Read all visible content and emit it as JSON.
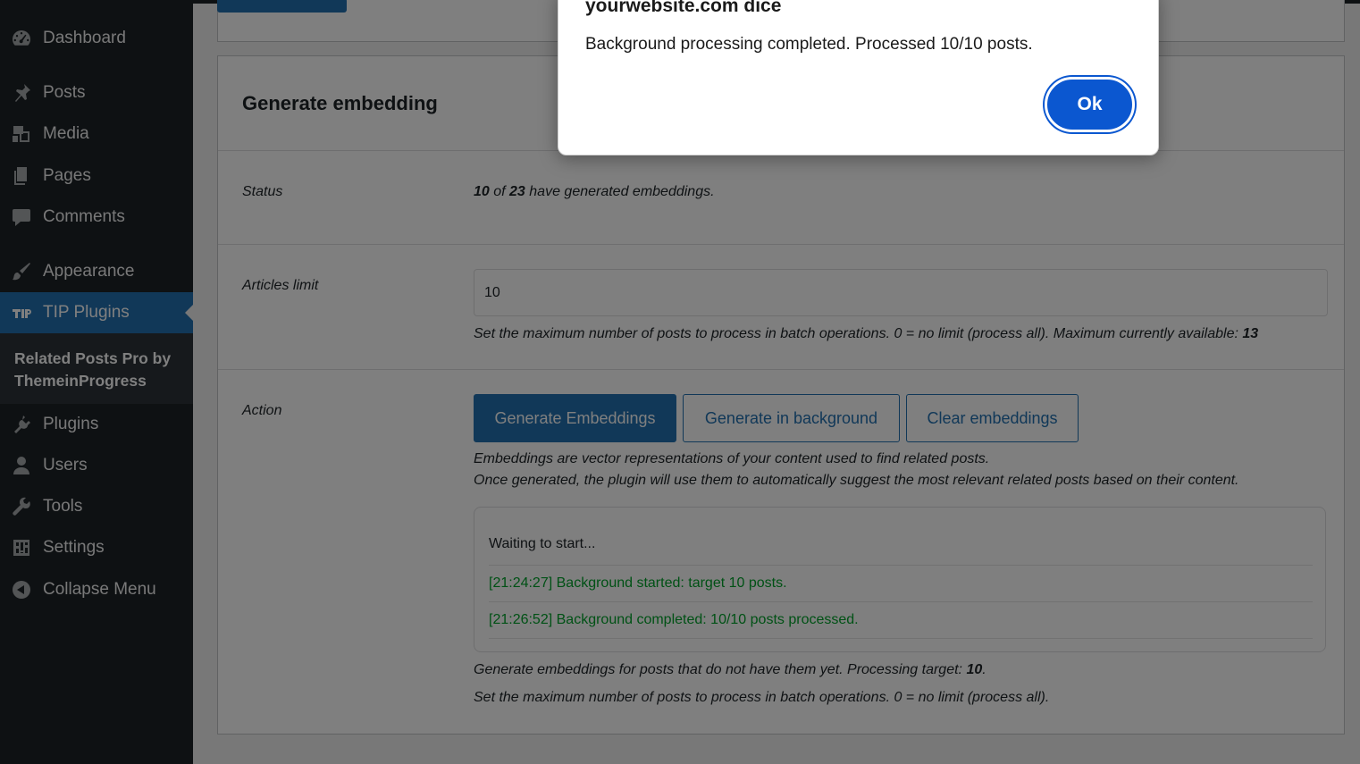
{
  "sidebar": {
    "items": [
      {
        "label": "Dashboard",
        "icon": "dashboard-icon"
      },
      {
        "label": "Posts",
        "icon": "pin-icon"
      },
      {
        "label": "Media",
        "icon": "media-icon"
      },
      {
        "label": "Pages",
        "icon": "pages-icon"
      },
      {
        "label": "Comments",
        "icon": "comment-icon"
      },
      {
        "label": "Appearance",
        "icon": "brush-icon"
      },
      {
        "label": "TIP Plugins",
        "icon": "tip-icon",
        "active": true
      },
      {
        "label": "Plugins",
        "icon": "plug-icon"
      },
      {
        "label": "Users",
        "icon": "user-icon"
      },
      {
        "label": "Tools",
        "icon": "wrench-icon"
      },
      {
        "label": "Settings",
        "icon": "sliders-icon"
      },
      {
        "label": "Collapse Menu",
        "icon": "collapse-icon"
      }
    ],
    "submenu_label": "Related Posts Pro by ThemeinProgress"
  },
  "card": {
    "title": "Generate embedding",
    "status": {
      "label": "Status",
      "done": "10",
      "of": " of ",
      "total": "23",
      "suffix": " have generated embeddings."
    },
    "limit": {
      "label": "Articles limit",
      "value": "10",
      "desc_prefix": "Set the maximum number of posts to process in batch operations. 0 = no limit (process all). Maximum currently available: ",
      "max_available": "13"
    },
    "action": {
      "label": "Action",
      "btn_generate": "Generate Embeddings",
      "btn_background": "Generate in background",
      "btn_clear": "Clear embeddings",
      "desc_line1": "Embeddings are vector representations of your content used to find related posts.",
      "desc_line2": "Once generated, the plugin will use them to automatically suggest the most relevant related posts based on their content.",
      "log": {
        "waiting": "Waiting to start...",
        "line1": "[21:24:27] Background started: target 10 posts.",
        "line2": "[21:26:52] Background completed: 10/10 posts processed."
      },
      "target_prefix": "Generate embeddings for posts that do not have them yet. Processing target: ",
      "target_value": "10",
      "target_suffix": ".",
      "limit_note": "Set the maximum number of posts to process in batch operations. 0 = no limit (process all)."
    }
  },
  "dialog": {
    "title": "yourwebsite.com dice",
    "message": "Background processing completed. Processed 10/10 posts.",
    "ok_label": "Ok"
  },
  "colors": {
    "wp_accent": "#2271b1",
    "sidebar_bg": "#1d2327",
    "log_green": "#00a32a",
    "dialog_button": "#0b57d0"
  }
}
